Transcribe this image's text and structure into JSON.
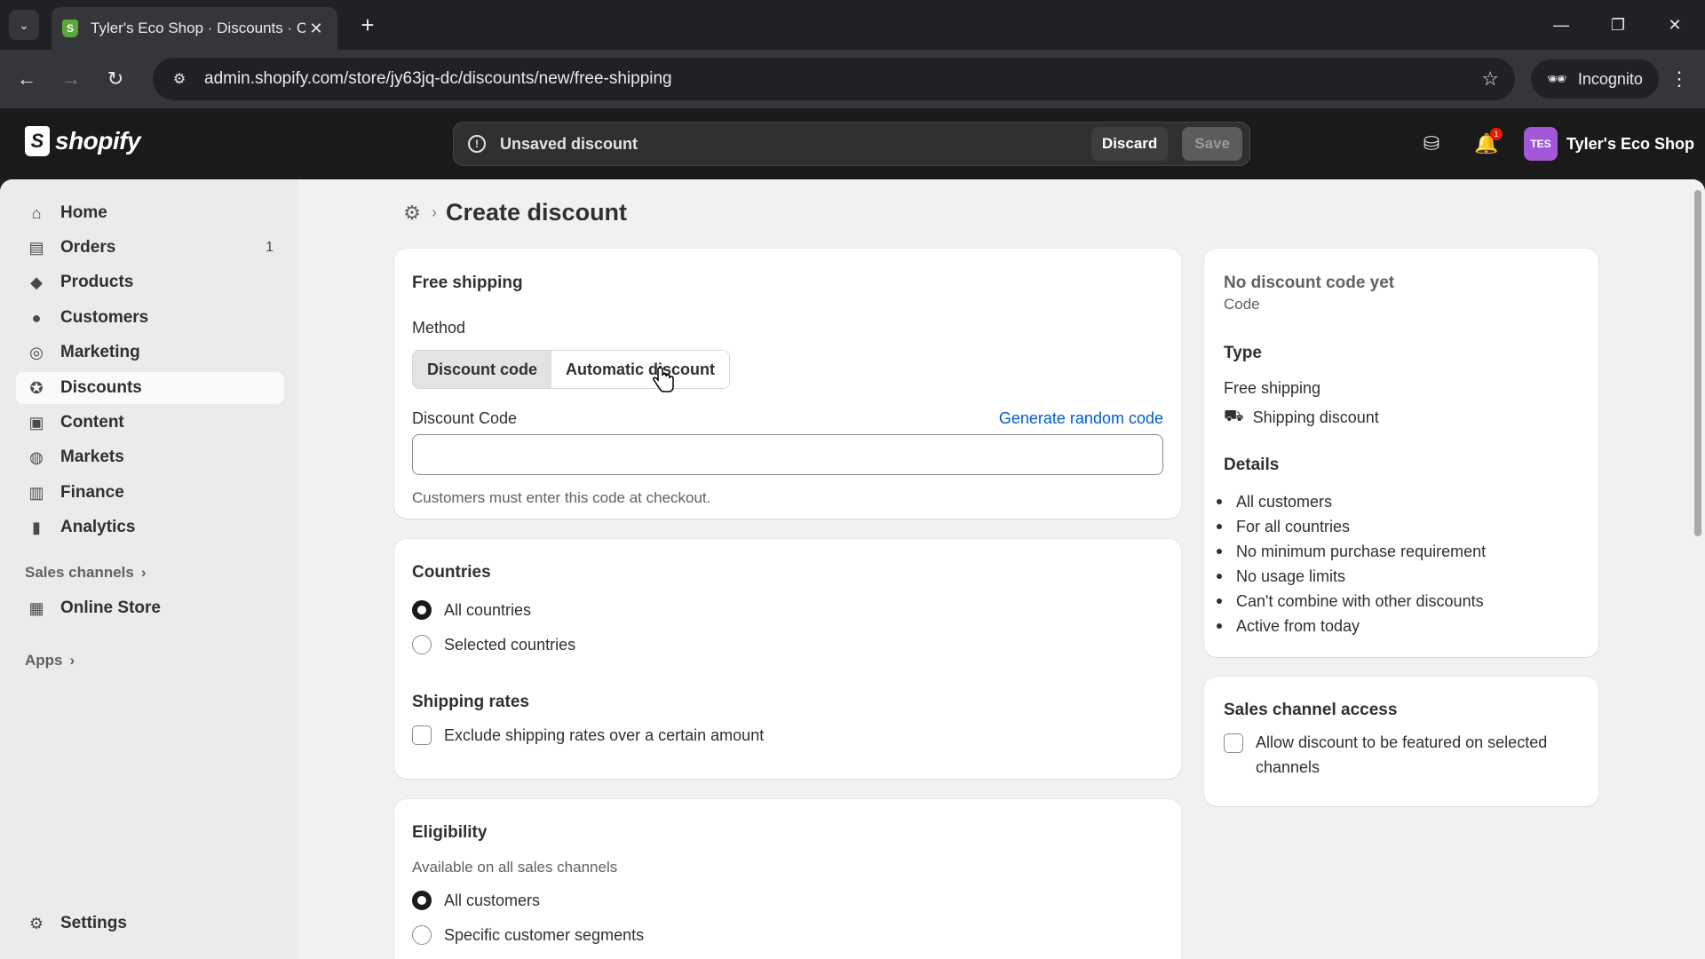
{
  "browser": {
    "tab_title": "Tyler's Eco Shop · Discounts · C",
    "url": "admin.shopify.com/store/jy63jq-dc/discounts/new/free-shipping",
    "incognito_label": "Incognito"
  },
  "topbar": {
    "logo_text": "shopify",
    "savebar_text": "Unsaved discount",
    "discard_label": "Discard",
    "save_label": "Save",
    "notification_count": "1",
    "avatar_initials": "TES",
    "store_name": "Tyler's Eco Shop"
  },
  "sidebar": {
    "items": [
      {
        "label": "Home",
        "icon": "home-icon"
      },
      {
        "label": "Orders",
        "icon": "orders-icon",
        "count": "1"
      },
      {
        "label": "Products",
        "icon": "tag-icon"
      },
      {
        "label": "Customers",
        "icon": "person-icon"
      },
      {
        "label": "Marketing",
        "icon": "target-icon"
      },
      {
        "label": "Discounts",
        "icon": "discount-icon"
      },
      {
        "label": "Content",
        "icon": "content-icon"
      },
      {
        "label": "Markets",
        "icon": "globe-icon"
      },
      {
        "label": "Finance",
        "icon": "bank-icon"
      },
      {
        "label": "Analytics",
        "icon": "bar-chart-icon"
      }
    ],
    "sales_channels_label": "Sales channels",
    "online_store_label": "Online Store",
    "apps_label": "Apps",
    "settings_label": "Settings"
  },
  "page": {
    "title": "Create discount"
  },
  "method_card": {
    "title": "Free shipping",
    "method_label": "Method",
    "method_options": [
      "Discount code",
      "Automatic discount"
    ],
    "selected_method": "Discount code",
    "code_label": "Discount Code",
    "generate_link": "Generate random code",
    "code_value": "",
    "help_text": "Customers must enter this code at checkout."
  },
  "countries_card": {
    "title": "Countries",
    "options": [
      "All countries",
      "Selected countries"
    ],
    "selected": "All countries",
    "shipping_rates_title": "Shipping rates",
    "exclude_label": "Exclude shipping rates over a certain amount",
    "exclude_checked": false
  },
  "eligibility_card": {
    "title": "Eligibility",
    "subtitle": "Available on all sales channels",
    "options": [
      "All customers",
      "Specific customer segments"
    ],
    "selected": "All customers"
  },
  "summary_card": {
    "code_title": "No discount code yet",
    "code_subtitle": "Code",
    "type_title": "Type",
    "type_value": "Free shipping",
    "type_detail": "Shipping discount",
    "details_title": "Details",
    "details": [
      "All customers",
      "For all countries",
      "No minimum purchase requirement",
      "No usage limits",
      "Can't combine with other discounts",
      "Active from today"
    ]
  },
  "sales_channel_card": {
    "title": "Sales channel access",
    "checkbox_label_line1": "Allow discount to be featured on selected",
    "checkbox_label_line2": "channels",
    "checked": false
  }
}
